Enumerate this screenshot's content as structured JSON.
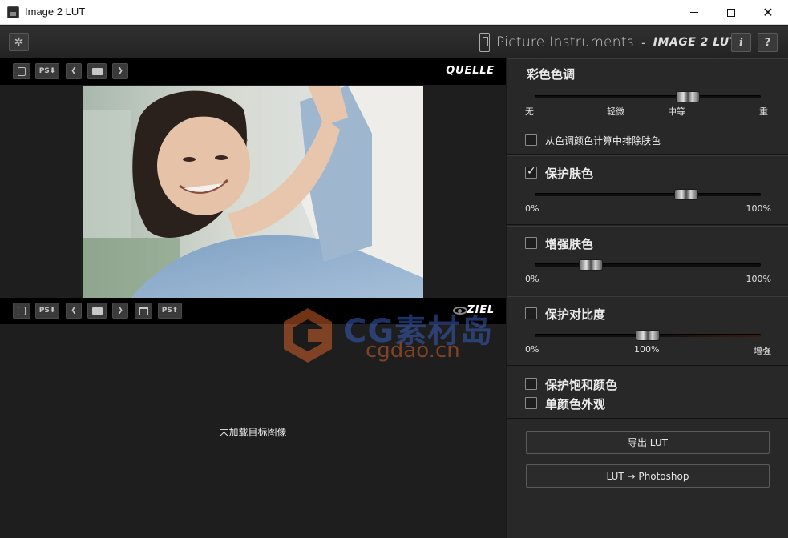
{
  "window": {
    "title": "Image 2 LUT",
    "minimize_icon": "minimize-icon",
    "maximize_icon": "maximize-icon",
    "close_icon": "close-icon"
  },
  "header": {
    "brand_name": "Picture Instruments",
    "separator": "-",
    "product_name": "IMAGE 2 LUT",
    "info_label": "i",
    "help_label": "?"
  },
  "source_toolbar": {
    "label": "QUELLE",
    "ps_import": "PS⬇",
    "prev": "❮",
    "next": "❯"
  },
  "target_toolbar": {
    "label": "ZIEL",
    "ps_import": "PS⬇",
    "prev": "❮",
    "next": "❯",
    "ps_export": "PS⬆"
  },
  "target_empty_message": "未加载目标图像",
  "watermark": {
    "line1": "CG素材岛",
    "line2": "cgdao.cn"
  },
  "panel": {
    "hue": {
      "title": "彩色色调",
      "value_fraction": 0.7,
      "ticks": [
        "无",
        "轻微",
        "中等",
        "重"
      ],
      "exclude_skin_label": "从色调颜色计算中排除肤色",
      "exclude_skin_checked": false
    },
    "protect_skin": {
      "label": "保护肤色",
      "checked": true,
      "value_fraction": 0.69,
      "min_label": "0%",
      "max_label": "100%"
    },
    "enhance_skin": {
      "label": "增强肤色",
      "checked": false,
      "value_fraction": 0.22,
      "min_label": "0%",
      "max_label": "100%"
    },
    "protect_contrast": {
      "label": "保护对比度",
      "checked": false,
      "value_fraction": 0.5,
      "min_label": "0%",
      "mid_label": "100%",
      "max_label": "增强"
    },
    "protect_saturation": {
      "label": "保护饱和颜色",
      "checked": false
    },
    "monochrome": {
      "label": "单颜色外观",
      "checked": false
    },
    "export_lut_button": "导出 LUT",
    "lut_to_photoshop_button": "LUT → Photoshop"
  },
  "colors": {
    "panel_bg": "#282828",
    "toolbar_bg": "#000000",
    "watermark_blue": "#3a63c9",
    "watermark_orange": "#e0662a"
  }
}
